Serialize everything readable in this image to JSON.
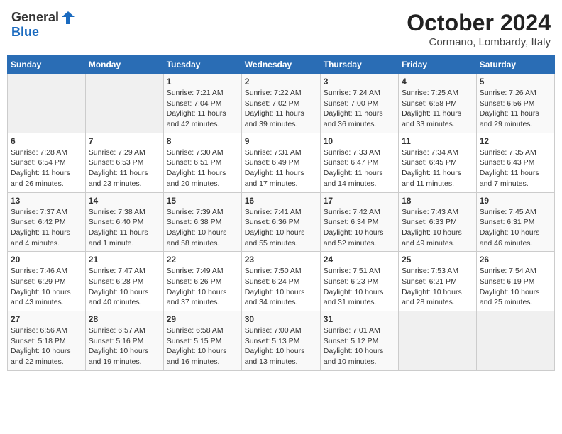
{
  "header": {
    "logo_general": "General",
    "logo_blue": "Blue",
    "month_title": "October 2024",
    "location": "Cormano, Lombardy, Italy"
  },
  "days_of_week": [
    "Sunday",
    "Monday",
    "Tuesday",
    "Wednesday",
    "Thursday",
    "Friday",
    "Saturday"
  ],
  "weeks": [
    [
      {
        "day": "",
        "empty": true
      },
      {
        "day": "",
        "empty": true
      },
      {
        "day": "1",
        "sunrise": "7:21 AM",
        "sunset": "7:04 PM",
        "daylight": "11 hours and 42 minutes."
      },
      {
        "day": "2",
        "sunrise": "7:22 AM",
        "sunset": "7:02 PM",
        "daylight": "11 hours and 39 minutes."
      },
      {
        "day": "3",
        "sunrise": "7:24 AM",
        "sunset": "7:00 PM",
        "daylight": "11 hours and 36 minutes."
      },
      {
        "day": "4",
        "sunrise": "7:25 AM",
        "sunset": "6:58 PM",
        "daylight": "11 hours and 33 minutes."
      },
      {
        "day": "5",
        "sunrise": "7:26 AM",
        "sunset": "6:56 PM",
        "daylight": "11 hours and 29 minutes."
      }
    ],
    [
      {
        "day": "6",
        "sunrise": "7:28 AM",
        "sunset": "6:54 PM",
        "daylight": "11 hours and 26 minutes."
      },
      {
        "day": "7",
        "sunrise": "7:29 AM",
        "sunset": "6:53 PM",
        "daylight": "11 hours and 23 minutes."
      },
      {
        "day": "8",
        "sunrise": "7:30 AM",
        "sunset": "6:51 PM",
        "daylight": "11 hours and 20 minutes."
      },
      {
        "day": "9",
        "sunrise": "7:31 AM",
        "sunset": "6:49 PM",
        "daylight": "11 hours and 17 minutes."
      },
      {
        "day": "10",
        "sunrise": "7:33 AM",
        "sunset": "6:47 PM",
        "daylight": "11 hours and 14 minutes."
      },
      {
        "day": "11",
        "sunrise": "7:34 AM",
        "sunset": "6:45 PM",
        "daylight": "11 hours and 11 minutes."
      },
      {
        "day": "12",
        "sunrise": "7:35 AM",
        "sunset": "6:43 PM",
        "daylight": "11 hours and 7 minutes."
      }
    ],
    [
      {
        "day": "13",
        "sunrise": "7:37 AM",
        "sunset": "6:42 PM",
        "daylight": "11 hours and 4 minutes."
      },
      {
        "day": "14",
        "sunrise": "7:38 AM",
        "sunset": "6:40 PM",
        "daylight": "11 hours and 1 minute."
      },
      {
        "day": "15",
        "sunrise": "7:39 AM",
        "sunset": "6:38 PM",
        "daylight": "10 hours and 58 minutes."
      },
      {
        "day": "16",
        "sunrise": "7:41 AM",
        "sunset": "6:36 PM",
        "daylight": "10 hours and 55 minutes."
      },
      {
        "day": "17",
        "sunrise": "7:42 AM",
        "sunset": "6:34 PM",
        "daylight": "10 hours and 52 minutes."
      },
      {
        "day": "18",
        "sunrise": "7:43 AM",
        "sunset": "6:33 PM",
        "daylight": "10 hours and 49 minutes."
      },
      {
        "day": "19",
        "sunrise": "7:45 AM",
        "sunset": "6:31 PM",
        "daylight": "10 hours and 46 minutes."
      }
    ],
    [
      {
        "day": "20",
        "sunrise": "7:46 AM",
        "sunset": "6:29 PM",
        "daylight": "10 hours and 43 minutes."
      },
      {
        "day": "21",
        "sunrise": "7:47 AM",
        "sunset": "6:28 PM",
        "daylight": "10 hours and 40 minutes."
      },
      {
        "day": "22",
        "sunrise": "7:49 AM",
        "sunset": "6:26 PM",
        "daylight": "10 hours and 37 minutes."
      },
      {
        "day": "23",
        "sunrise": "7:50 AM",
        "sunset": "6:24 PM",
        "daylight": "10 hours and 34 minutes."
      },
      {
        "day": "24",
        "sunrise": "7:51 AM",
        "sunset": "6:23 PM",
        "daylight": "10 hours and 31 minutes."
      },
      {
        "day": "25",
        "sunrise": "7:53 AM",
        "sunset": "6:21 PM",
        "daylight": "10 hours and 28 minutes."
      },
      {
        "day": "26",
        "sunrise": "7:54 AM",
        "sunset": "6:19 PM",
        "daylight": "10 hours and 25 minutes."
      }
    ],
    [
      {
        "day": "27",
        "sunrise": "6:56 AM",
        "sunset": "5:18 PM",
        "daylight": "10 hours and 22 minutes."
      },
      {
        "day": "28",
        "sunrise": "6:57 AM",
        "sunset": "5:16 PM",
        "daylight": "10 hours and 19 minutes."
      },
      {
        "day": "29",
        "sunrise": "6:58 AM",
        "sunset": "5:15 PM",
        "daylight": "10 hours and 16 minutes."
      },
      {
        "day": "30",
        "sunrise": "7:00 AM",
        "sunset": "5:13 PM",
        "daylight": "10 hours and 13 minutes."
      },
      {
        "day": "31",
        "sunrise": "7:01 AM",
        "sunset": "5:12 PM",
        "daylight": "10 hours and 10 minutes."
      },
      {
        "day": "",
        "empty": true
      },
      {
        "day": "",
        "empty": true
      }
    ]
  ],
  "labels": {
    "sunrise": "Sunrise:",
    "sunset": "Sunset:",
    "daylight": "Daylight:"
  }
}
